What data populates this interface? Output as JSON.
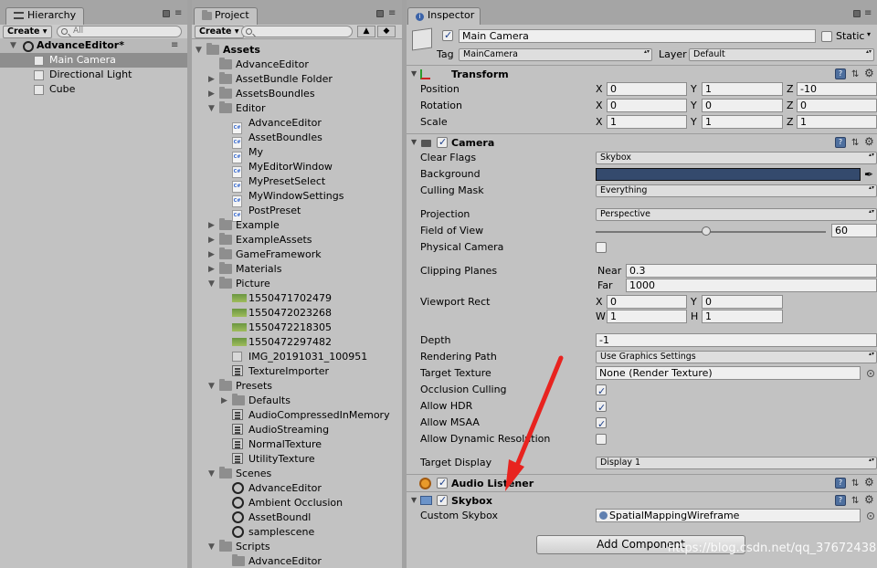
{
  "hierarchy": {
    "tab": "Hierarchy",
    "create": "Create",
    "search_placeholder": "All",
    "scene": "AdvanceEditor*",
    "items": [
      "Main Camera",
      "Directional Light",
      "Cube"
    ]
  },
  "project": {
    "tab": "Project",
    "create": "Create",
    "assets": "Assets",
    "folders_top": [
      "AdvanceEditor",
      "AssetBundle Folder",
      "AssetsBoundles"
    ],
    "editor": "Editor",
    "editor_items": [
      "AdvanceEditor",
      "AssetBoundles",
      "My",
      "MyEditorWindow",
      "MyPresetSelect",
      "MyWindowSettings",
      "PostPreset"
    ],
    "folders_mid": [
      "Example",
      "ExampleAssets",
      "GameFramework",
      "Materials"
    ],
    "picture": "Picture",
    "picture_items": [
      "1550471702479",
      "1550472023268",
      "1550472218305",
      "1550472297482",
      "IMG_20191031_100951",
      "TextureImporter"
    ],
    "presets": "Presets",
    "presets_items": [
      "Defaults",
      "AudioCompressedInMemory",
      "AudioStreaming",
      "NormalTexture",
      "UtilityTexture"
    ],
    "scenes": "Scenes",
    "scene_items": [
      "AdvanceEditor",
      "Ambient Occlusion",
      "AssetBoundl",
      "samplescene"
    ],
    "scripts": "Scripts",
    "script_items": [
      "AdvanceEditor"
    ]
  },
  "inspector": {
    "tab": "Inspector",
    "name": "Main Camera",
    "static": "Static",
    "tag_label": "Tag",
    "tag": "MainCamera",
    "layer_label": "Layer",
    "layer": "Default",
    "transform": {
      "title": "Transform",
      "position": "Position",
      "rotation": "Rotation",
      "scale": "Scale",
      "x": "X",
      "y": "Y",
      "z": "Z",
      "pos": [
        "0",
        "1",
        "-10"
      ],
      "rot": [
        "0",
        "0",
        "0"
      ],
      "scl": [
        "1",
        "1",
        "1"
      ]
    },
    "camera": {
      "title": "Camera",
      "clear_flags": "Clear Flags",
      "clear_flags_val": "Skybox",
      "background": "Background",
      "background_color": "#344a6d",
      "culling_mask": "Culling Mask",
      "culling_mask_val": "Everything",
      "projection": "Projection",
      "projection_val": "Perspective",
      "fov": "Field of View",
      "fov_val": "60",
      "fov_fraction": 0.48,
      "physical": "Physical Camera",
      "clipping": "Clipping Planes",
      "near": "Near",
      "near_val": "0.3",
      "far": "Far",
      "far_val": "1000",
      "viewport": "Viewport Rect",
      "vx": "0",
      "vy": "0",
      "vw": "1",
      "vh": "1",
      "w": "W",
      "h": "H",
      "depth": "Depth",
      "depth_val": "-1",
      "rendering": "Rendering Path",
      "rendering_val": "Use Graphics Settings",
      "target_texture": "Target Texture",
      "target_texture_val": "None (Render Texture)",
      "occlusion": "Occlusion Culling",
      "hdr": "Allow HDR",
      "msaa": "Allow MSAA",
      "dynres": "Allow Dynamic Resolution",
      "target_display": "Target Display",
      "target_display_val": "Display 1"
    },
    "audio": {
      "title": "Audio Listener"
    },
    "skybox": {
      "title": "Skybox",
      "custom": "Custom Skybox",
      "custom_val": "SpatialMappingWireframe"
    },
    "add_component": "Add Component"
  },
  "watermark": "https://blog.csdn.net/qq_37672438",
  "colors": {
    "panel": "#c2c2c2",
    "selection": "#8e8e8e",
    "arrow": "#e8231f"
  }
}
